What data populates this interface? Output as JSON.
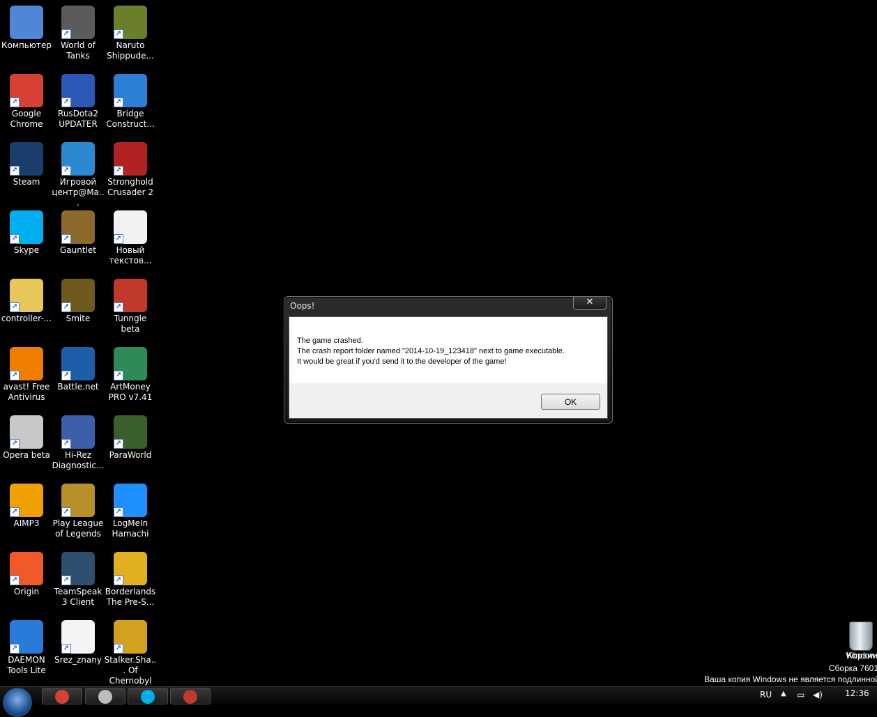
{
  "desktop": {
    "icons": [
      {
        "label": "Компьютер",
        "color": "#4f86d6"
      },
      {
        "label": "World of Tanks",
        "color": "#5b5b5b"
      },
      {
        "label": "Naruto Shippude...",
        "color": "#6b7f2a"
      },
      {
        "label": "Google Chrome",
        "color": "#d64035"
      },
      {
        "label": "RusDota2 UPDATER",
        "color": "#2c58b7"
      },
      {
        "label": "Bridge Construct...",
        "color": "#2c7fd6"
      },
      {
        "label": "Steam",
        "color": "#1b3d6b"
      },
      {
        "label": "Игровой центр@Ma...",
        "color": "#2b89d2"
      },
      {
        "label": "Stronghold Crusader 2",
        "color": "#b22222"
      },
      {
        "label": "Skype",
        "color": "#00aff0"
      },
      {
        "label": "Gauntlet",
        "color": "#8b6a2b"
      },
      {
        "label": "Новый текстов...",
        "color": "#f2f2f2"
      },
      {
        "label": "controller-...",
        "color": "#e8c75a"
      },
      {
        "label": "Smite",
        "color": "#6d5a1c"
      },
      {
        "label": "Tunngle beta",
        "color": "#c0392b"
      },
      {
        "label": "avast! Free Antivirus",
        "color": "#f07d00"
      },
      {
        "label": "Battle.net",
        "color": "#1c5fa8"
      },
      {
        "label": "ArtMoney PRO v7.41",
        "color": "#2e8b57"
      },
      {
        "label": "Opera beta",
        "color": "#c8c8c8"
      },
      {
        "label": "Hi-Rez Diagnostic...",
        "color": "#3b5fa8"
      },
      {
        "label": "ParaWorld",
        "color": "#3a5f2a"
      },
      {
        "label": "AIMP3",
        "color": "#f0a000"
      },
      {
        "label": "Play League of Legends",
        "color": "#b8902a"
      },
      {
        "label": "LogMeIn Hamachi",
        "color": "#1e90ff"
      },
      {
        "label": "Origin",
        "color": "#f05a28"
      },
      {
        "label": "TeamSpeak 3 Client",
        "color": "#2f4f6f"
      },
      {
        "label": "Borderlands The Pre-S...",
        "color": "#e0b020"
      },
      {
        "label": "DAEMON Tools Lite",
        "color": "#2a7ad9"
      },
      {
        "label": "Srez_znany",
        "color": "#f4f4f4"
      },
      {
        "label": "Stalker.Sha... Of Chernobyl",
        "color": "#d4a020"
      }
    ]
  },
  "dialog": {
    "title": "Oops!",
    "close_label": "✕",
    "lines": [
      "The game crashed.",
      "The crash report folder named \"2014-10-19_123418\" next to game executable.",
      "It would be great if you'd send it to the developer of the game!"
    ],
    "ok_label": "OK"
  },
  "recycle_bin": {
    "label": "Корзина"
  },
  "watermark": {
    "line1": "Windows",
    "line2": "Сборка 7601",
    "line3": "Ваша копия Windows не является подлинной"
  },
  "taskbar": {
    "language": "RU",
    "time": "12:36",
    "pinned": [
      {
        "name": "chrome",
        "color": "#d64035"
      },
      {
        "name": "opera",
        "color": "#bdbdbd"
      },
      {
        "name": "skype",
        "color": "#00aff0"
      },
      {
        "name": "game",
        "color": "#c0392b"
      }
    ]
  }
}
